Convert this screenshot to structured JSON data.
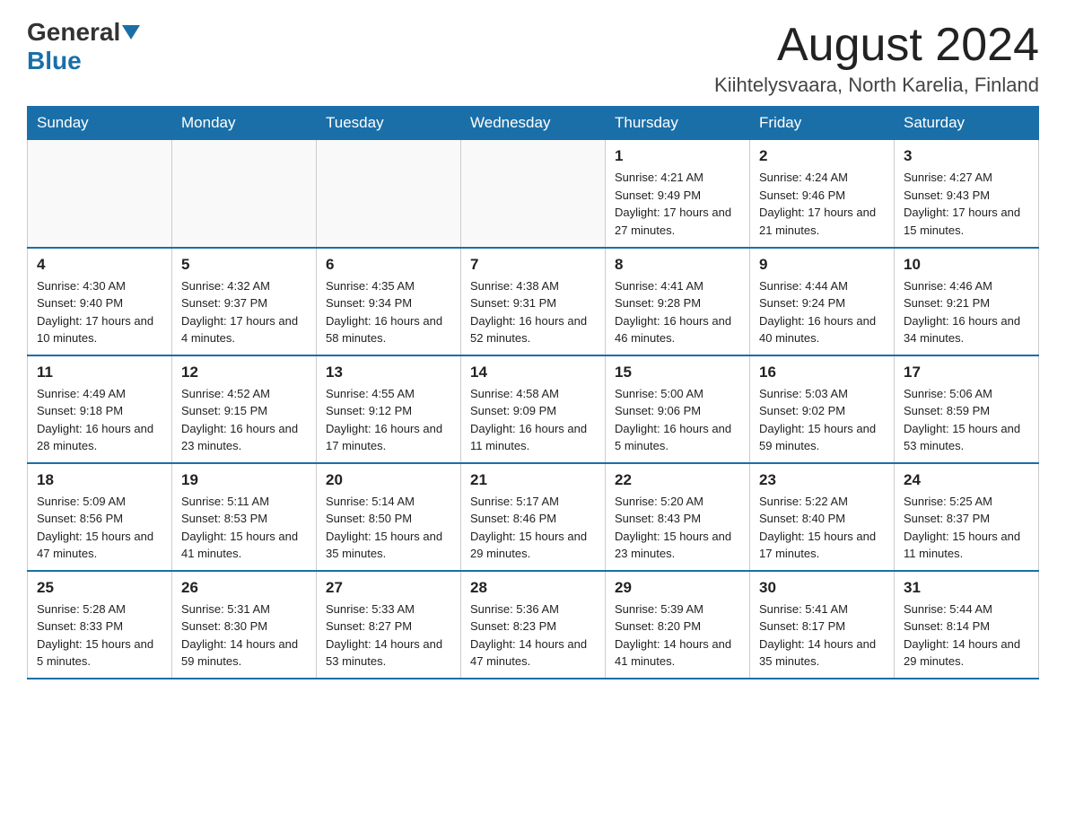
{
  "logo": {
    "general": "General",
    "blue": "Blue"
  },
  "header": {
    "month": "August 2024",
    "location": "Kiihtelysvaara, North Karelia, Finland"
  },
  "days_of_week": [
    "Sunday",
    "Monday",
    "Tuesday",
    "Wednesday",
    "Thursday",
    "Friday",
    "Saturday"
  ],
  "weeks": [
    [
      {
        "day": "",
        "info": ""
      },
      {
        "day": "",
        "info": ""
      },
      {
        "day": "",
        "info": ""
      },
      {
        "day": "",
        "info": ""
      },
      {
        "day": "1",
        "info": "Sunrise: 4:21 AM\nSunset: 9:49 PM\nDaylight: 17 hours\nand 27 minutes."
      },
      {
        "day": "2",
        "info": "Sunrise: 4:24 AM\nSunset: 9:46 PM\nDaylight: 17 hours\nand 21 minutes."
      },
      {
        "day": "3",
        "info": "Sunrise: 4:27 AM\nSunset: 9:43 PM\nDaylight: 17 hours\nand 15 minutes."
      }
    ],
    [
      {
        "day": "4",
        "info": "Sunrise: 4:30 AM\nSunset: 9:40 PM\nDaylight: 17 hours\nand 10 minutes."
      },
      {
        "day": "5",
        "info": "Sunrise: 4:32 AM\nSunset: 9:37 PM\nDaylight: 17 hours\nand 4 minutes."
      },
      {
        "day": "6",
        "info": "Sunrise: 4:35 AM\nSunset: 9:34 PM\nDaylight: 16 hours\nand 58 minutes."
      },
      {
        "day": "7",
        "info": "Sunrise: 4:38 AM\nSunset: 9:31 PM\nDaylight: 16 hours\nand 52 minutes."
      },
      {
        "day": "8",
        "info": "Sunrise: 4:41 AM\nSunset: 9:28 PM\nDaylight: 16 hours\nand 46 minutes."
      },
      {
        "day": "9",
        "info": "Sunrise: 4:44 AM\nSunset: 9:24 PM\nDaylight: 16 hours\nand 40 minutes."
      },
      {
        "day": "10",
        "info": "Sunrise: 4:46 AM\nSunset: 9:21 PM\nDaylight: 16 hours\nand 34 minutes."
      }
    ],
    [
      {
        "day": "11",
        "info": "Sunrise: 4:49 AM\nSunset: 9:18 PM\nDaylight: 16 hours\nand 28 minutes."
      },
      {
        "day": "12",
        "info": "Sunrise: 4:52 AM\nSunset: 9:15 PM\nDaylight: 16 hours\nand 23 minutes."
      },
      {
        "day": "13",
        "info": "Sunrise: 4:55 AM\nSunset: 9:12 PM\nDaylight: 16 hours\nand 17 minutes."
      },
      {
        "day": "14",
        "info": "Sunrise: 4:58 AM\nSunset: 9:09 PM\nDaylight: 16 hours\nand 11 minutes."
      },
      {
        "day": "15",
        "info": "Sunrise: 5:00 AM\nSunset: 9:06 PM\nDaylight: 16 hours\nand 5 minutes."
      },
      {
        "day": "16",
        "info": "Sunrise: 5:03 AM\nSunset: 9:02 PM\nDaylight: 15 hours\nand 59 minutes."
      },
      {
        "day": "17",
        "info": "Sunrise: 5:06 AM\nSunset: 8:59 PM\nDaylight: 15 hours\nand 53 minutes."
      }
    ],
    [
      {
        "day": "18",
        "info": "Sunrise: 5:09 AM\nSunset: 8:56 PM\nDaylight: 15 hours\nand 47 minutes."
      },
      {
        "day": "19",
        "info": "Sunrise: 5:11 AM\nSunset: 8:53 PM\nDaylight: 15 hours\nand 41 minutes."
      },
      {
        "day": "20",
        "info": "Sunrise: 5:14 AM\nSunset: 8:50 PM\nDaylight: 15 hours\nand 35 minutes."
      },
      {
        "day": "21",
        "info": "Sunrise: 5:17 AM\nSunset: 8:46 PM\nDaylight: 15 hours\nand 29 minutes."
      },
      {
        "day": "22",
        "info": "Sunrise: 5:20 AM\nSunset: 8:43 PM\nDaylight: 15 hours\nand 23 minutes."
      },
      {
        "day": "23",
        "info": "Sunrise: 5:22 AM\nSunset: 8:40 PM\nDaylight: 15 hours\nand 17 minutes."
      },
      {
        "day": "24",
        "info": "Sunrise: 5:25 AM\nSunset: 8:37 PM\nDaylight: 15 hours\nand 11 minutes."
      }
    ],
    [
      {
        "day": "25",
        "info": "Sunrise: 5:28 AM\nSunset: 8:33 PM\nDaylight: 15 hours\nand 5 minutes."
      },
      {
        "day": "26",
        "info": "Sunrise: 5:31 AM\nSunset: 8:30 PM\nDaylight: 14 hours\nand 59 minutes."
      },
      {
        "day": "27",
        "info": "Sunrise: 5:33 AM\nSunset: 8:27 PM\nDaylight: 14 hours\nand 53 minutes."
      },
      {
        "day": "28",
        "info": "Sunrise: 5:36 AM\nSunset: 8:23 PM\nDaylight: 14 hours\nand 47 minutes."
      },
      {
        "day": "29",
        "info": "Sunrise: 5:39 AM\nSunset: 8:20 PM\nDaylight: 14 hours\nand 41 minutes."
      },
      {
        "day": "30",
        "info": "Sunrise: 5:41 AM\nSunset: 8:17 PM\nDaylight: 14 hours\nand 35 minutes."
      },
      {
        "day": "31",
        "info": "Sunrise: 5:44 AM\nSunset: 8:14 PM\nDaylight: 14 hours\nand 29 minutes."
      }
    ]
  ]
}
